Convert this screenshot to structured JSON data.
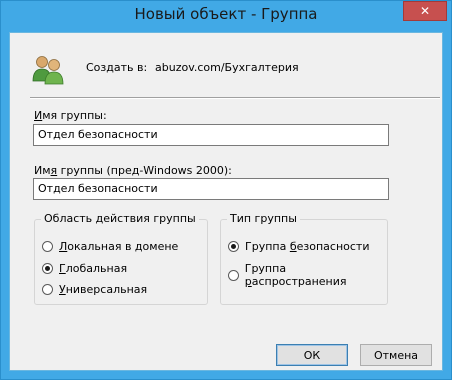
{
  "window": {
    "title": "Новый объект - Группа",
    "close_symbol": "✕"
  },
  "header": {
    "create_label": "Создать в:",
    "create_path": "abuzov.com/Бухгалтерия",
    "icon": "users-icon"
  },
  "fields": {
    "group_name": {
      "label_u": "И",
      "label_rest": "мя группы:",
      "value": "Отдел безопасности"
    },
    "group_name_pre2000": {
      "label_pre": "Им",
      "label_u": "я",
      "label_rest": " группы (пред-Windows 2000):",
      "value": "Отдел безопасности"
    }
  },
  "scope": {
    "legend": "Область действия группы",
    "options": [
      {
        "u": "Л",
        "rest": "окальная в домене",
        "checked": false
      },
      {
        "u": "Г",
        "rest": "лобальная",
        "checked": true
      },
      {
        "u": "У",
        "rest": "ниверсальная",
        "checked": false
      }
    ]
  },
  "type": {
    "legend": "Тип группы",
    "options": [
      {
        "pre": "Группа ",
        "u": "б",
        "rest": "езопасности",
        "checked": true
      },
      {
        "pre": "Группа ",
        "u": "р",
        "rest": "аспространения",
        "checked": false
      }
    ]
  },
  "buttons": {
    "ok": "ОК",
    "cancel": "Отмена"
  }
}
